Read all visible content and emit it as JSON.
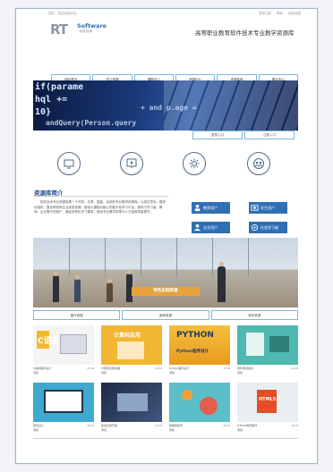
{
  "topbar": {
    "left_text": "您好，欢迎光临本站",
    "links": [
      "登录注册",
      "帮助",
      "网站地图"
    ]
  },
  "logo": {
    "mark": "RT",
    "brand": "Software",
    "subtitle": "软件技术"
  },
  "site_title": "高等职业教育软件技术专业教学资源库",
  "nav": [
    "网站首页",
    "学习资源",
    "课程中心",
    "资源中心",
    "资源检索",
    "展示中心"
  ],
  "sub_tabs": [
    "登录入口",
    "注册入口"
  ],
  "banner_code": {
    "l1": "if(parame",
    "l2": "hql +=",
    "l3": "10}",
    "l4": "andQuery(Person.query",
    "l5": "+ and p.age ="
  },
  "feature_icons": [
    "monitor-icon",
    "screen-play-icon",
    "gear-icon",
    "people-group-icon"
  ],
  "intro": {
    "title": "资源库简介",
    "text": "软件技术专业资源库是一个开放、共享、智能、动态的专业教学资源库。以岗位导向，模块化组织，整合院校和企业优质资源，建设以课程为核心的数字化学习平台，服务于学习者、教师、企业等不同用户，满足多样化学习需求，推动专业教学改革与人才培养质量提升。"
  },
  "user_buttons": [
    {
      "label": "教师用户",
      "icon": "teacher-icon"
    },
    {
      "label": "学生用户",
      "icon": "student-icon"
    },
    {
      "label": "企业用户",
      "icon": "enterprise-icon"
    },
    {
      "label": "社会学习者",
      "icon": "learner-icon"
    }
  ],
  "photo_caption": "特色实践资源",
  "photo_tabs": [
    "操作资源",
    "案例资源",
    "软件资源"
  ],
  "cards": [
    {
      "title": "C语言",
      "caption": "C语言程序设计",
      "author": "课程",
      "count": "2018"
    },
    {
      "title": "计算机应用",
      "caption": "计算机应用基础",
      "author": "课程",
      "count": "2018"
    },
    {
      "title": "PYTHON",
      "caption": "Python程序设计",
      "author": "课程",
      "count": "2018"
    },
    {
      "title": "",
      "caption": "软件测试技术",
      "author": "课程",
      "count": "2018"
    },
    {
      "title": "",
      "caption": "网页设计",
      "author": "课程",
      "count": "2018"
    },
    {
      "title": "",
      "caption": "移动应用开发",
      "author": "课程",
      "count": "2018"
    },
    {
      "title": "",
      "caption": "数据库技术",
      "author": "课程",
      "count": "2018"
    },
    {
      "title": "HTML5",
      "caption": "HTML5网页制作",
      "author": "课程",
      "count": "2018"
    }
  ],
  "colors": {
    "accent": "#2f6fb5",
    "nav_border": "#7fb8d8",
    "orange": "#e8a23a"
  }
}
